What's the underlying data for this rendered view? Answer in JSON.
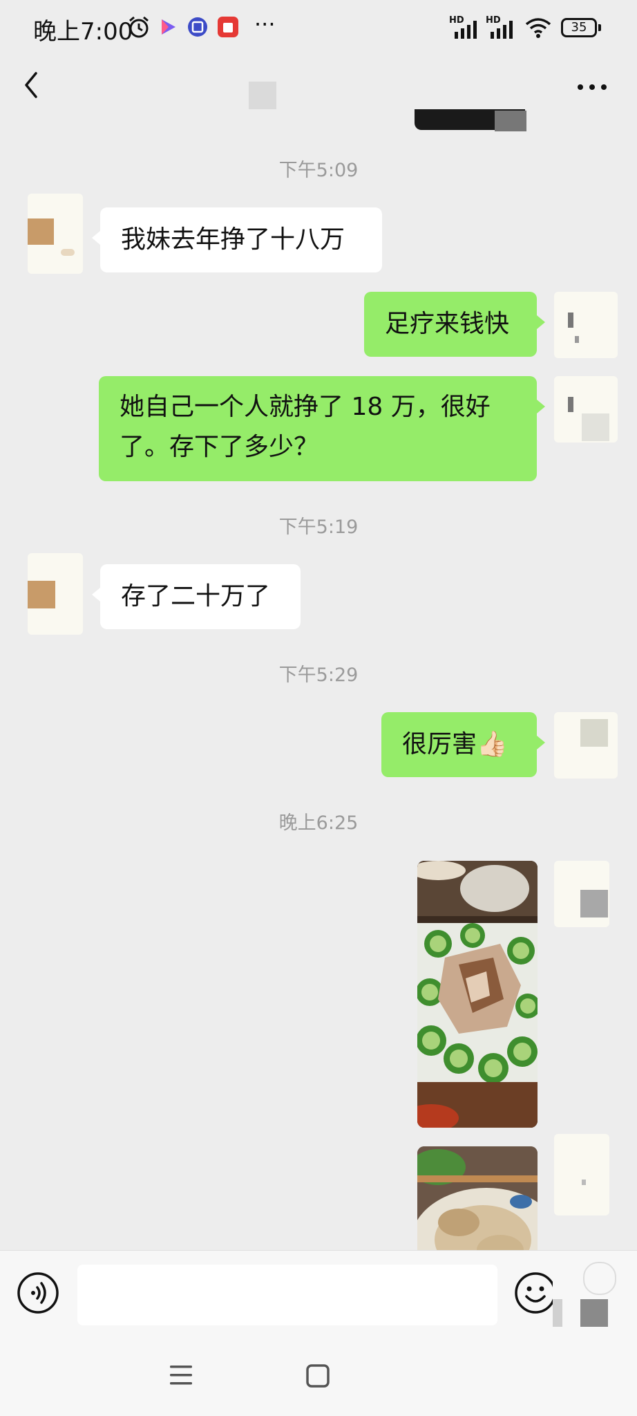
{
  "status_bar": {
    "time": "晚上7:00",
    "battery": "35",
    "signal_label_1": "HD",
    "signal_label_2": "HD",
    "more": "···"
  },
  "nav": {
    "back_icon": "chevron-left-icon",
    "more_icon": "more-horizontal-icon"
  },
  "messages": [
    {
      "kind": "timestamp",
      "text": "下午5:09"
    },
    {
      "kind": "incoming",
      "text": "我妹去年挣了十八万"
    },
    {
      "kind": "outgoing",
      "text": "足疗来钱快"
    },
    {
      "kind": "outgoing",
      "text": "她自己一个人就挣了 18 万，很好了。存下了多少？"
    },
    {
      "kind": "timestamp",
      "text": "下午5:19"
    },
    {
      "kind": "incoming",
      "text": "存了二十万了"
    },
    {
      "kind": "timestamp",
      "text": "下午5:29"
    },
    {
      "kind": "outgoing",
      "text": "很厉害👍🏻"
    },
    {
      "kind": "timestamp",
      "text": "晚上6:25"
    },
    {
      "kind": "outgoing-image",
      "subject": "food-photo-cucumber-meat"
    },
    {
      "kind": "outgoing-image",
      "subject": "food-photo-chopsticks-bowl"
    }
  ],
  "input_bar": {
    "voice_icon": "voice-icon",
    "emoji_icon": "emoji-icon",
    "placeholder": ""
  },
  "system_nav": {
    "menu_icon": "menu-icon",
    "home_icon": "home-icon"
  },
  "colors": {
    "background": "#EDEDED",
    "outgoing_bubble": "#95EC69",
    "incoming_bubble": "#FFFFFF",
    "timestamp": "#9A9A9A"
  }
}
